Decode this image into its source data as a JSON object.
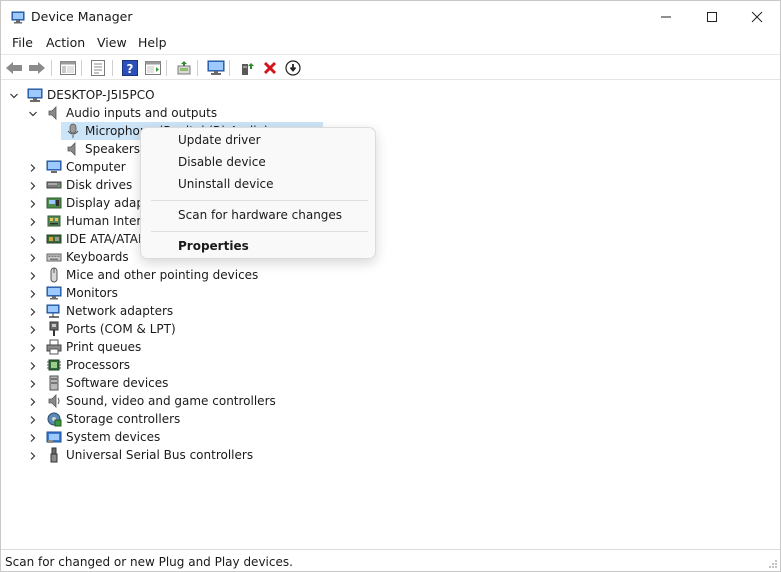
{
  "window": {
    "title": "Device Manager"
  },
  "menu": {
    "file": "File",
    "action": "Action",
    "view": "View",
    "help": "Help"
  },
  "toolbar": {
    "icons": [
      "back-icon",
      "forward-icon",
      "show-hide-console-tree-icon",
      "properties-icon",
      "help-icon",
      "action-pane-icon",
      "update-driver-icon",
      "scan-hardware-icon",
      "add-legacy-hardware-icon",
      "uninstall-device-icon",
      "disable-device-icon"
    ]
  },
  "tree": {
    "root": "DESKTOP-J5I5PCO",
    "audio": {
      "label": "Audio inputs and outputs",
      "children": [
        "Microphone (Realtek(R) Audio)",
        "Speakers (Realtek(R) Audio)"
      ]
    },
    "categories": [
      "Computer",
      "Disk drives",
      "Display adapters",
      "Human Interface Devices",
      "IDE ATA/ATAPI controllers",
      "Keyboards",
      "Mice and other pointing devices",
      "Monitors",
      "Network adapters",
      "Ports (COM & LPT)",
      "Print queues",
      "Processors",
      "Software devices",
      "Sound, video and game controllers",
      "Storage controllers",
      "System devices",
      "Universal Serial Bus controllers"
    ]
  },
  "context_menu": {
    "update_driver": "Update driver",
    "disable_device": "Disable device",
    "uninstall_device": "Uninstall device",
    "scan_hardware": "Scan for hardware changes",
    "properties": "Properties"
  },
  "status": {
    "text": "Scan for changed or new Plug and Play devices."
  },
  "colors": {
    "selection": "#cce4f7",
    "accent": "#0067c0"
  }
}
